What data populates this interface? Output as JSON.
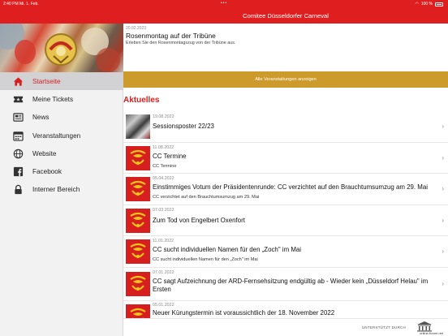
{
  "status_bar": {
    "time": "2:40 PM  Mi. 1. Feb.",
    "battery": "100 %"
  },
  "header": {
    "title": "Comitee Düsseldorfer Carneval"
  },
  "sidebar": {
    "items": [
      {
        "label": "Startseite",
        "icon": "home-icon",
        "active": true
      },
      {
        "label": "Meine Tickets",
        "icon": "ticket-icon",
        "active": false
      },
      {
        "label": "News",
        "icon": "news-icon",
        "active": false
      },
      {
        "label": "Veranstaltungen",
        "icon": "calendar-icon",
        "active": false
      },
      {
        "label": "Website",
        "icon": "globe-icon",
        "active": false
      },
      {
        "label": "Facebook",
        "icon": "facebook-icon",
        "active": false
      },
      {
        "label": "Interner Bereich",
        "icon": "lock-icon",
        "active": false
      }
    ]
  },
  "featured": {
    "date": "20.02.2023",
    "title": "Rosenmontag auf der Tribüne",
    "subtitle": "Erleben Sie den Rosenmontagszug von der Tribüne aus."
  },
  "all_events_button": "Alle Veranstaltungen anzeigen",
  "news_section": {
    "title": "Aktuelles",
    "items": [
      {
        "date": "19.08.2022",
        "title": "Sessionsposter 22/23",
        "subtitle": "",
        "thumb": "photo"
      },
      {
        "date": "11.08.2022",
        "title": "CC Termine",
        "subtitle": "CC Termine",
        "thumb": "emblem"
      },
      {
        "date": "05.04.2022",
        "title": "Einstimmiges Votum der Präsidentenrunde: CC verzichtet auf den Brauchtumsumzug am 29. Mai",
        "subtitle": "CC verzichtet auf den Brauchtumsumzug am 29. Mai",
        "thumb": "emblem"
      },
      {
        "date": "07.03.2022",
        "title": "Zum Tod von Engelbert Oxenfort",
        "subtitle": "",
        "thumb": "emblem"
      },
      {
        "date": "11.01.2022",
        "title": "CC sucht individuellen Namen für den „Zoch\" im Mai",
        "subtitle": "CC sucht individuellen Namen für den „Zoch\" im Mai",
        "thumb": "emblem"
      },
      {
        "date": "07.01.2022",
        "title": "CC sagt Aufzeichnung der ARD-Fernsehsitzung endgültig ab - Wieder kein „Düsseldorf Helau\" im Ersten",
        "subtitle": "",
        "thumb": "emblem"
      },
      {
        "date": "05.01.2022",
        "title": "Neuer Kürungstermin ist voraussichtlich der 18. November 2022",
        "subtitle": "",
        "thumb": "emblem"
      }
    ]
  },
  "footer": {
    "supported_by": "UNTERSTÜTZT DURCH",
    "brand": "online-forum.net"
  },
  "colors": {
    "brand_red": "#df1f1f",
    "gold_button": "#cc9b2b",
    "active_text": "#d31f1f"
  }
}
